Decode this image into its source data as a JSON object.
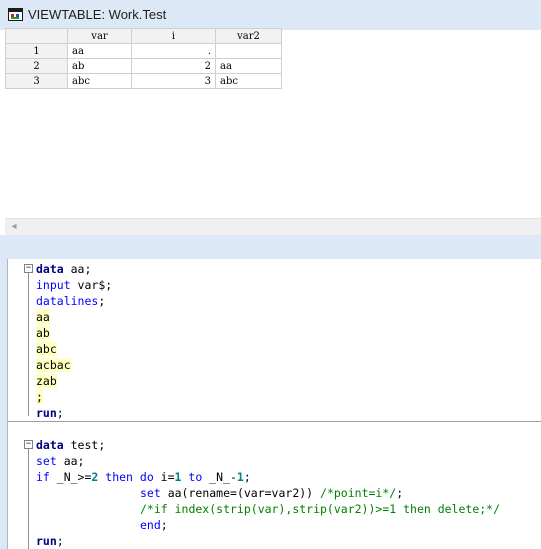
{
  "window": {
    "title": "VIEWTABLE: Work.Test",
    "app_icon": "sas-viewtable-icon"
  },
  "table": {
    "columns": [
      "var",
      "i",
      "var2"
    ],
    "rows": [
      {
        "num": "1",
        "var": "aa",
        "i": ".",
        "var2": ""
      },
      {
        "num": "2",
        "var": "ab",
        "i": "2",
        "var2": "aa"
      },
      {
        "num": "3",
        "var": "abc",
        "i": "3",
        "var2": "abc"
      }
    ]
  },
  "scrollbar": {
    "left_arrow": "◂"
  },
  "editor": {
    "fold_glyph": "−",
    "block1": {
      "l1_kw": "data",
      "l1_rest": " aa;",
      "l2_kw": "input",
      "l2_rest": " var$;",
      "l3_kw": "datalines",
      "l3_rest": ";",
      "datalines": [
        "aa",
        "ab",
        "abc",
        "acbac",
        "zab"
      ],
      "l9": ";",
      "l10_kw": "run",
      "l10_rest": ";"
    },
    "block2": {
      "l1_kw": "data",
      "l1_rest": " test;",
      "l2_kw": "set",
      "l2_rest": " aa;",
      "l3_if": "if",
      "l3_a": " _N_>=",
      "l3_n2": "2",
      "l3_then": " then",
      "l3_do": " do",
      "l3_b": " i=",
      "l3_n1": "1",
      "l3_to": " to",
      "l3_c": " _N_-",
      "l3_n1b": "1",
      "l3_d": ";",
      "l4_set": "set",
      "l4_a": " aa(rename=(var=var2)) ",
      "l4_cmt": "/*point=i*/",
      "l4_end": ";",
      "l5_cmt": "/*if index(strip(var),strip(var2))>=1 then delete;*/",
      "l6_end": "end",
      "l6_rest": ";",
      "l7_kw": "run",
      "l7_rest": ";"
    }
  }
}
